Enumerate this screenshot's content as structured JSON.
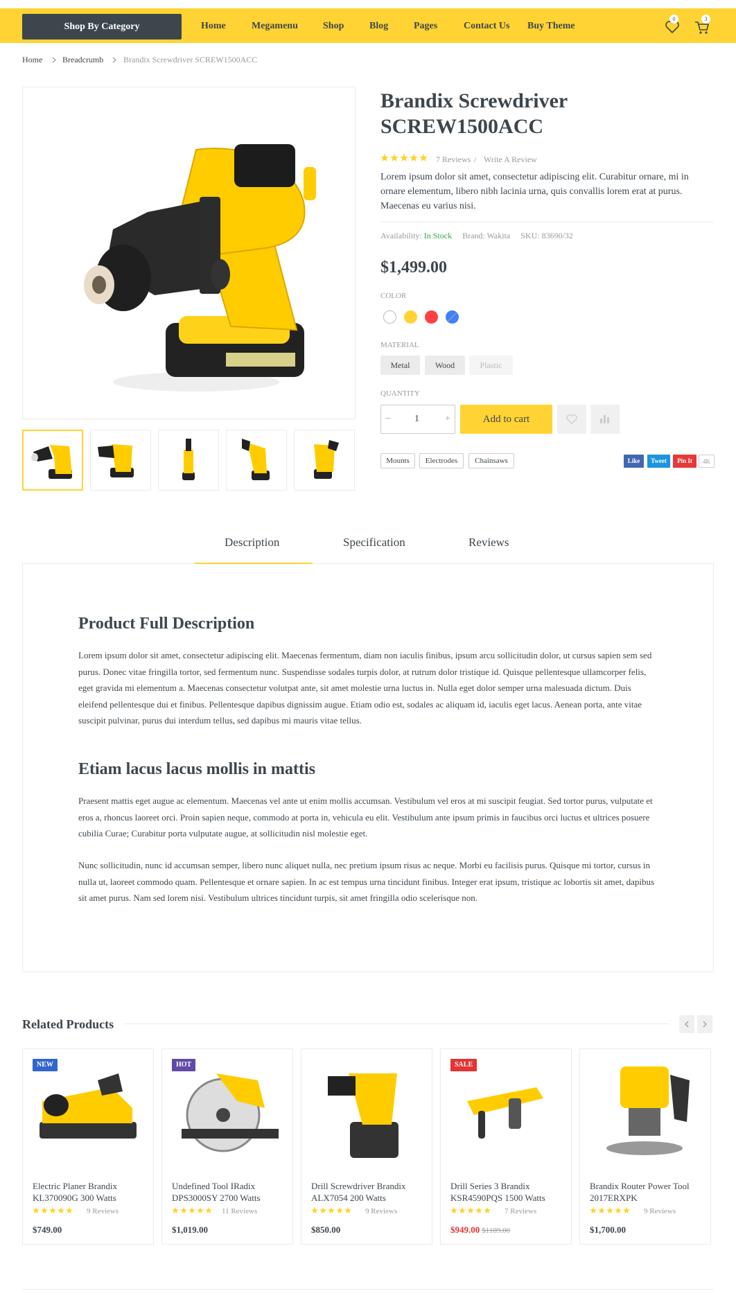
{
  "nav": {
    "category_button": "Shop By Category",
    "items": [
      "Home",
      "Megamenu",
      "Shop",
      "Blog",
      "Pages",
      "Contact Us",
      "Buy Theme"
    ],
    "wishlist_count": "0",
    "cart_count": "3"
  },
  "breadcrumb": [
    "Home",
    "Breadcrumb",
    "Brandix Screwdriver SCREW1500ACC"
  ],
  "product": {
    "title": "Brandix Screwdriver SCREW1500ACC",
    "rating": 5,
    "reviews": "7 Reviews",
    "write_review": "Write A Review",
    "description": "Lorem ipsum dolor sit amet, consectetur adipiscing elit. Curabitur ornare, mi in ornare elementum, libero nibh lacinia urna, quis convallis lorem erat at purus. Maecenas eu varius nisi.",
    "availability_label": "Availability:",
    "availability_value": "In Stock",
    "brand": "Brand: Wakita",
    "sku": "SKU: 83690/32",
    "price": "$1,499.00",
    "color_label": "COLOR",
    "colors": [
      "#ffffff",
      "#ffd333",
      "#ff4040",
      "#4080ff"
    ],
    "material_label": "MATERIAL",
    "materials": [
      "Metal",
      "Wood",
      "Plastic"
    ],
    "quantity_label": "QUANTITY",
    "quantity": "1",
    "minus": "−",
    "plus": "+",
    "add_to_cart": "Add to cart",
    "tags": [
      "Mounts",
      "Electrodes",
      "Chainsaws"
    ],
    "share": {
      "like": "Like",
      "tweet": "Tweet",
      "pin": "Pin It",
      "count": "4K"
    },
    "share_colors": {
      "like": "#4267b2",
      "tweet": "#1b95e0",
      "pin": "#e63939"
    }
  },
  "tabs": [
    "Description",
    "Specification",
    "Reviews"
  ],
  "description": {
    "heading1": "Product Full Description",
    "para1": "Lorem ipsum dolor sit amet, consectetur adipiscing elit. Maecenas fermentum, diam non iaculis finibus, ipsum arcu sollicitudin dolor, ut cursus sapien sem sed purus. Donec vitae fringilla tortor, sed fermentum nunc. Suspendisse sodales turpis dolor, at rutrum dolor tristique id. Quisque pellentesque ullamcorper felis, eget gravida mi elementum a. Maecenas consectetur volutpat ante, sit amet molestie urna luctus in. Nulla eget dolor semper urna malesuada dictum. Duis eleifend pellentesque dui et finibus. Pellentesque dapibus dignissim augue. Etiam odio est, sodales ac aliquam id, iaculis eget lacus. Aenean porta, ante vitae suscipit pulvinar, purus dui interdum tellus, sed dapibus mi mauris vitae tellus.",
    "heading2": "Etiam lacus lacus mollis in mattis",
    "para2": "Praesent mattis eget augue ac elementum. Maecenas vel ante ut enim mollis accumsan. Vestibulum vel eros at mi suscipit feugiat. Sed tortor purus, vulputate et eros a, rhoncus laoreet orci. Proin sapien neque, commodo at porta in, vehicula eu elit. Vestibulum ante ipsum primis in faucibus orci luctus et ultrices posuere cubilia Curae; Curabitur porta vulputate augue, at sollicitudin nisl molestie eget.",
    "para3": "Nunc sollicitudin, nunc id accumsan semper, libero nunc aliquet nulla, nec pretium ipsum risus ac neque. Morbi eu facilisis purus. Quisque mi tortor, cursus in nulla ut, laoreet commodo quam. Pellentesque et ornare sapien. In ac est tempus urna tincidunt finibus. Integer erat ipsum, tristique ac lobortis sit amet, dapibus sit amet purus. Nam sed lorem nisi. Vestibulum ultrices tincidunt turpis, sit amet fringilla odio scelerisque non."
  },
  "related": {
    "title": "Related Products",
    "items": [
      {
        "badge": "NEW",
        "badge_color": "#3366cc",
        "name": "Electric Planer Brandix KL370090G 300 Watts",
        "reviews": "9 Reviews",
        "price": "$749.00",
        "old_price": ""
      },
      {
        "badge": "HOT",
        "badge_color": "#614ba6",
        "name": "Undefined Tool IRadix DPS3000SY 2700 Watts",
        "reviews": "11 Reviews",
        "price": "$1,019.00",
        "old_price": ""
      },
      {
        "badge": "",
        "badge_color": "",
        "name": "Drill Screwdriver Brandix ALX7054 200 Watts",
        "reviews": "9 Reviews",
        "price": "$850.00",
        "old_price": ""
      },
      {
        "badge": "SALE",
        "badge_color": "#e53333",
        "name": "Drill Series 3 Brandix KSR4590PQS 1500 Watts",
        "reviews": "7 Reviews",
        "price": "$949.00",
        "old_price": "$1189.00"
      },
      {
        "badge": "",
        "badge_color": "",
        "name": "Brandix Router Power Tool 2017ERXPK",
        "reviews": "9 Reviews",
        "price": "$1,700.00",
        "old_price": ""
      }
    ]
  }
}
